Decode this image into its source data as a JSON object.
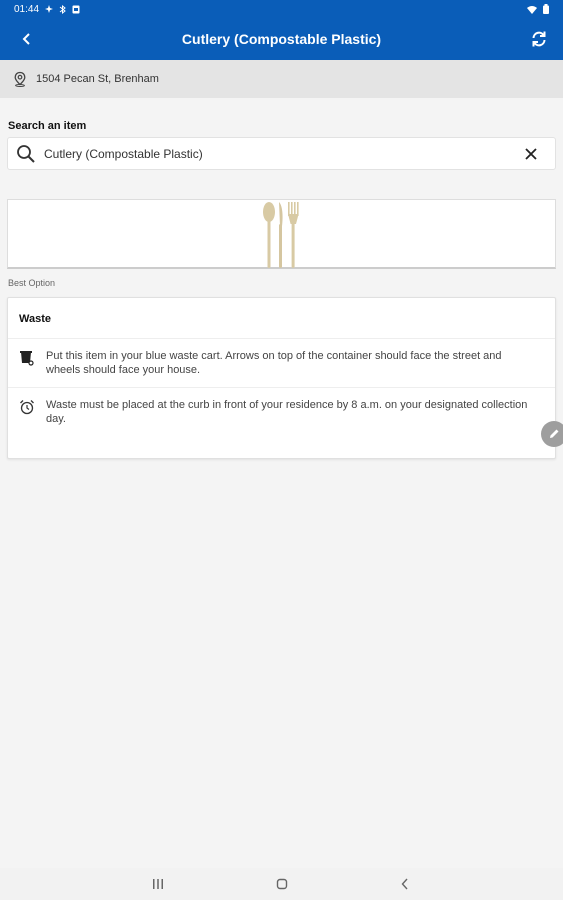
{
  "status": {
    "time": "01:44"
  },
  "header": {
    "title": "Cutlery (Compostable Plastic)"
  },
  "location": {
    "address": "1504 Pecan St, Brenham"
  },
  "search": {
    "label": "Search an item",
    "value": "Cutlery (Compostable Plastic)"
  },
  "result": {
    "section_label": "Best Option",
    "title": "Waste",
    "instructions": [
      {
        "icon": "waste-cart-icon",
        "text": "Put this item in your blue waste cart. Arrows on top of the container should face the street and wheels should face your house."
      },
      {
        "icon": "alarm-clock-icon",
        "text": "Waste must be placed at the curb in front of your residence by 8 a.m. on your designated collection day."
      }
    ]
  },
  "colors": {
    "app_bar": "#0a5db8",
    "card_bg": "#ffffff",
    "page_bg": "#f4f4f4"
  }
}
